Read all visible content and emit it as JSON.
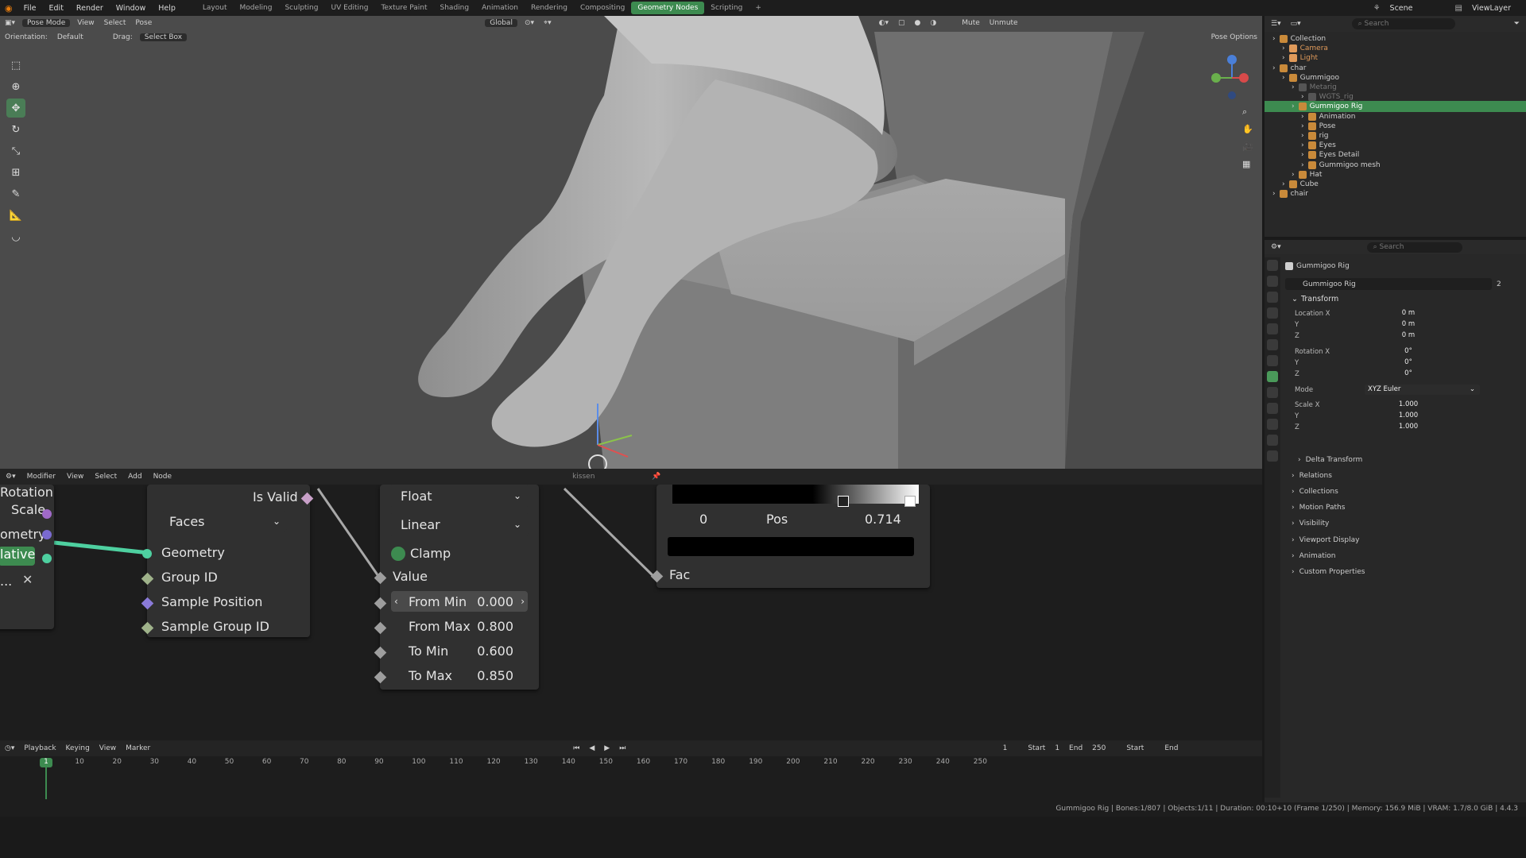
{
  "menu": [
    "File",
    "Edit",
    "Render",
    "Window",
    "Help"
  ],
  "workspaces": [
    "Layout",
    "Modeling",
    "Sculpting",
    "UV Editing",
    "Texture Paint",
    "Shading",
    "Animation",
    "Rendering",
    "Compositing",
    "Geometry Nodes",
    "Scripting"
  ],
  "active_workspace": "Geometry Nodes",
  "top_right": {
    "scene": "Scene",
    "view_layer": "ViewLayer"
  },
  "viewport": {
    "mode": "Pose Mode",
    "view": "View",
    "select": "Select",
    "pose": "Pose",
    "orientation_label": "Orientation:",
    "orientation_value": "Default",
    "drag_label": "Drag:",
    "drag_value": "Select Box",
    "transform_orientation": "Global",
    "mute": "Mute",
    "unmute": "Unmute",
    "pose_options": "Pose Options"
  },
  "node_editor": {
    "menus": [
      "Modifier",
      "View",
      "Select",
      "Add",
      "Node"
    ],
    "object_field": "kissen",
    "left_node": {
      "rotation": "Rotation",
      "scale": "Scale",
      "geometry": "ometry",
      "button": "lative",
      "dots": "..."
    },
    "sample_node": {
      "is_valid": "Is Valid",
      "domain": "Faces",
      "inputs": [
        "Geometry",
        "Group ID",
        "Sample Position",
        "Sample Group ID"
      ]
    },
    "map_range": {
      "data_type": "Float",
      "interpolation": "Linear",
      "clamp": "Clamp",
      "value": "Value",
      "from_min_label": "From Min",
      "from_min": "0.000",
      "from_max_label": "From Max",
      "from_max": "0.800",
      "to_min_label": "To Min",
      "to_min": "0.600",
      "to_max_label": "To Max",
      "to_max": "0.850"
    },
    "color_ramp": {
      "index": "0",
      "pos_label": "Pos",
      "pos": "0.714",
      "fac": "Fac"
    }
  },
  "timeline": {
    "menus": [
      "Playback",
      "Keying",
      "View",
      "Marker"
    ],
    "current_frame": "1",
    "start_label": "Start",
    "start": "1",
    "end_label": "End",
    "end": "250",
    "start2": "Start",
    "end2": "End",
    "ticks": [
      "1",
      "10",
      "20",
      "30",
      "40",
      "50",
      "60",
      "70",
      "80",
      "90",
      "100",
      "110",
      "120",
      "130",
      "140",
      "150",
      "160",
      "170",
      "180",
      "190",
      "200",
      "210",
      "220",
      "230",
      "240",
      "250"
    ]
  },
  "status": "Gummigoo Rig | Bones:1/807 | Objects:1/11 | Duration: 00:10+10 (Frame 1/250) | Memory: 156.9 MiB | VRAM: 1.7/8.0 GiB | 4.4.3",
  "outliner": {
    "search": "Search",
    "rows": [
      {
        "label": "Collection",
        "indent": 0,
        "color": "#cfcfcf"
      },
      {
        "label": "Camera",
        "indent": 1,
        "color": "#e09a5a"
      },
      {
        "label": "Light",
        "indent": 1,
        "color": "#e09a5a"
      },
      {
        "label": "char",
        "indent": 0,
        "color": "#cfcfcf"
      },
      {
        "label": "Gummigoo",
        "indent": 1,
        "color": "#cfcfcf"
      },
      {
        "label": "Metarig",
        "indent": 2,
        "color": "#777"
      },
      {
        "label": "WGTS_rig",
        "indent": 3,
        "color": "#777"
      },
      {
        "label": "Gummigoo Rig",
        "indent": 2,
        "color": "#ffffff"
      },
      {
        "label": "Animation",
        "indent": 3,
        "color": "#cfcfcf"
      },
      {
        "label": "Pose",
        "indent": 3,
        "color": "#cfcfcf"
      },
      {
        "label": "rig",
        "indent": 3,
        "color": "#cfcfcf"
      },
      {
        "label": "Eyes",
        "indent": 3,
        "color": "#cfcfcf"
      },
      {
        "label": "Eyes Detail",
        "indent": 3,
        "color": "#cfcfcf"
      },
      {
        "label": "Gummigoo mesh",
        "indent": 3,
        "color": "#cfcfcf"
      },
      {
        "label": "Hat",
        "indent": 2,
        "color": "#cfcfcf"
      },
      {
        "label": "Cube",
        "indent": 1,
        "color": "#cfcfcf"
      },
      {
        "label": "chair",
        "indent": 0,
        "color": "#cfcfcf"
      }
    ]
  },
  "properties": {
    "search": "Search",
    "object_name": "Gummigoo Rig",
    "data_name": "Gummigoo Rig",
    "users": "2",
    "transform": "Transform",
    "location_x_label": "Location X",
    "y_label": "Y",
    "z_label": "Z",
    "location": [
      "0 m",
      "0 m",
      "0 m"
    ],
    "rotation_x_label": "Rotation X",
    "rotation": [
      "0°",
      "0°",
      "0°"
    ],
    "mode_label": "Mode",
    "mode": "XYZ Euler",
    "scale_x_label": "Scale X",
    "scale": [
      "1.000",
      "1.000",
      "1.000"
    ],
    "sections": [
      "Delta Transform",
      "Relations",
      "Collections",
      "Motion Paths",
      "Visibility",
      "Viewport Display",
      "Animation",
      "Custom Properties"
    ]
  }
}
